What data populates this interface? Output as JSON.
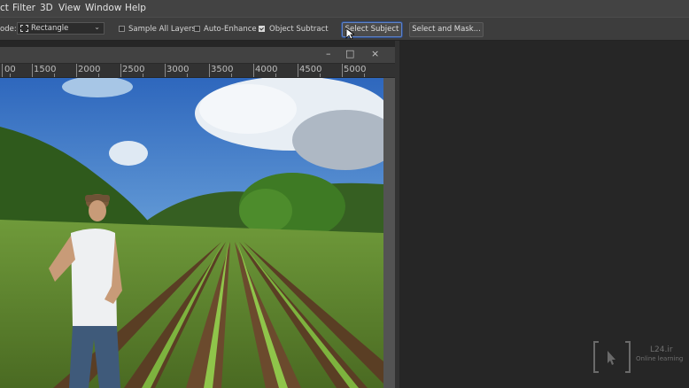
{
  "menu": {
    "items": [
      {
        "label": "ct"
      },
      {
        "label": "Filter"
      },
      {
        "label": "3D"
      },
      {
        "label": "View"
      },
      {
        "label": "Window"
      },
      {
        "label": "Help"
      }
    ]
  },
  "options": {
    "mode_label": "ode:",
    "mode_value": "Rectangle",
    "sample_all_layers": {
      "label": "Sample All Layers",
      "checked": false
    },
    "auto_enhance": {
      "label": "Auto-Enhance",
      "checked": false
    },
    "object_subtract": {
      "label": "Object Subtract",
      "checked": true
    },
    "select_subject_label": "Select Subject",
    "select_and_mask_label": "Select and Mask..."
  },
  "document": {
    "window_controls": {
      "minimize": "–",
      "restore": "□",
      "close": "×"
    },
    "ruler_labels": [
      "00",
      "1500",
      "2000",
      "2500",
      "3000",
      "3500",
      "4000",
      "4500",
      "5000"
    ]
  },
  "watermark": {
    "brand": "L24.ir",
    "tagline": "Online learning"
  }
}
